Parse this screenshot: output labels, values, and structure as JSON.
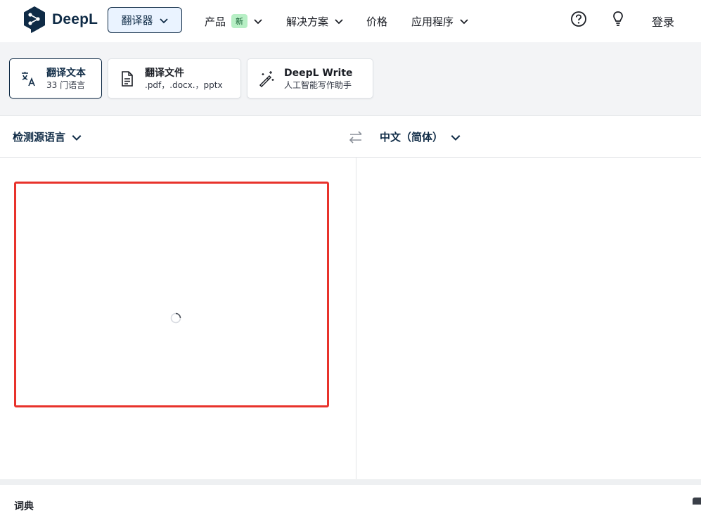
{
  "header": {
    "brand": "DeepL",
    "translator_label": "翻译器",
    "nav": [
      {
        "label": "产品",
        "badge": "新"
      },
      {
        "label": "解决方案"
      },
      {
        "label": "价格"
      },
      {
        "label": "应用程序"
      }
    ],
    "login_label": "登录",
    "icons": [
      "help-icon",
      "lightbulb-icon"
    ]
  },
  "modes": [
    {
      "title": "翻译文本",
      "subtitle": "33 门语言",
      "icon": "translate-icon",
      "active": true
    },
    {
      "title": "翻译文件",
      "subtitle": ".pdf，.docx.，pptx",
      "icon": "document-icon",
      "active": false
    },
    {
      "title": "DeepL Write",
      "subtitle": "人工智能写作助手",
      "icon": "magic-wand-icon",
      "active": false
    }
  ],
  "languages": {
    "source": "检测源语言",
    "target": "中文（简体）"
  },
  "footer": {
    "label": "词典"
  },
  "colors": {
    "brand": "#0f2b46",
    "highlight_border": "#e8322b",
    "active_bg": "#eaf3ff",
    "new_badge": "#b7efc5"
  }
}
